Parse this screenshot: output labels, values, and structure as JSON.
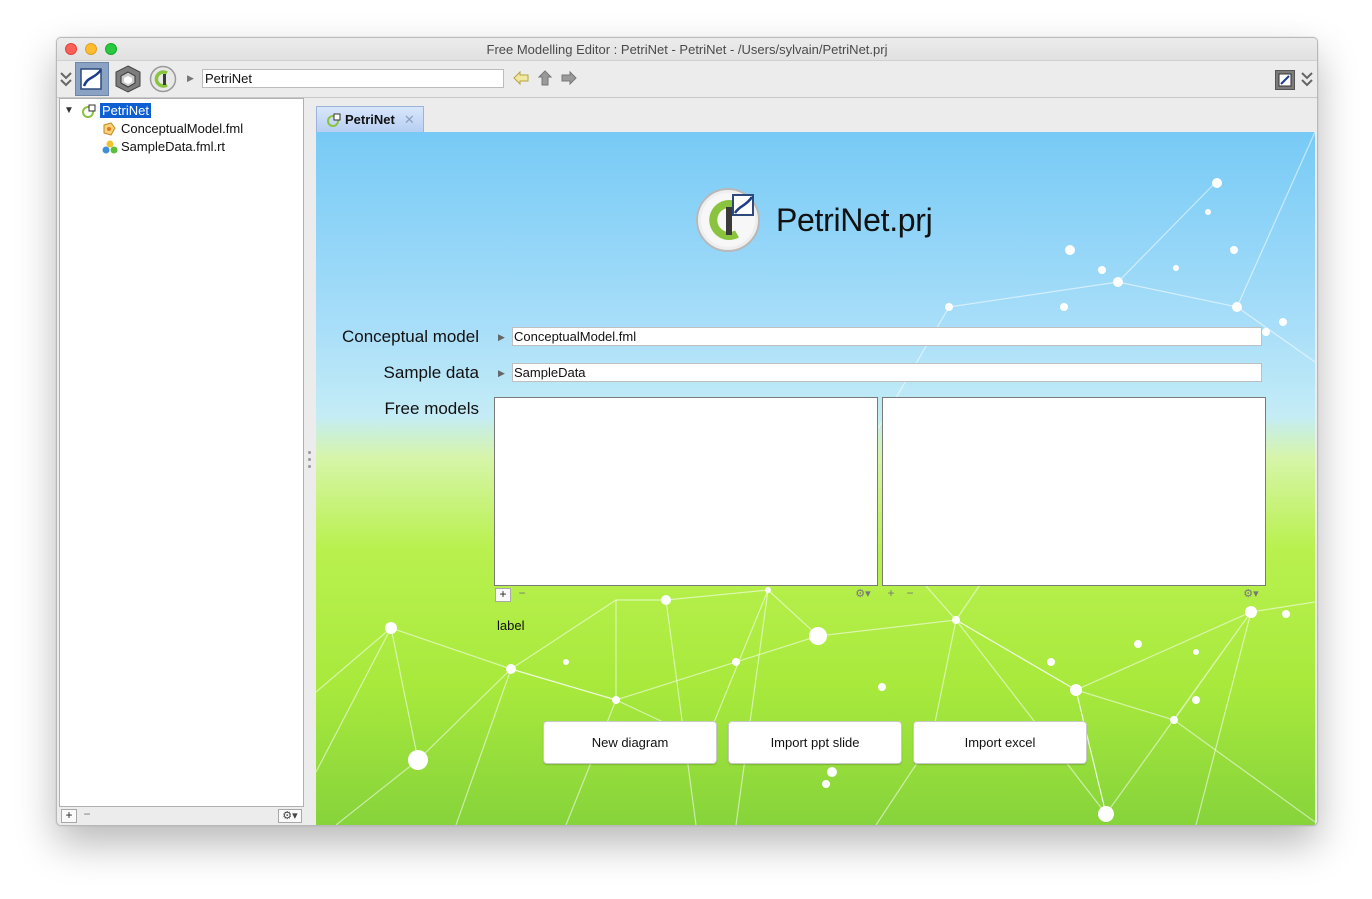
{
  "window": {
    "title": "Free Modelling Editor : PetriNet - PetriNet - /Users/sylvain/PetriNet.prj"
  },
  "toolbar": {
    "path_value": "PetriNet",
    "icons": [
      "collapse-chevrons-icon",
      "free-modelling-perspective-icon",
      "technology-cube-icon",
      "openflexo-logo-icon",
      "back-arrow-icon",
      "up-arrow-icon",
      "forward-arrow-icon",
      "toggle-inspector-icon",
      "expand-chevrons-icon"
    ]
  },
  "tree": {
    "root": "PetriNet",
    "children": [
      "ConceptualModel.fml",
      "SampleData.fml.rt"
    ]
  },
  "left_footer": {
    "add": "+",
    "remove": "−",
    "gear": "⚙▾"
  },
  "tab": {
    "label": "PetriNet",
    "close": "✕"
  },
  "main": {
    "project_title": "PetriNet.prj",
    "conceptual_model_label": "Conceptual model",
    "conceptual_model_value": "ConceptualModel.fml",
    "sample_data_label": "Sample data",
    "sample_data_value": "SampleData",
    "free_models_label": "Free models",
    "list_add": "+",
    "list_remove": "−",
    "list_gear": "⚙▾",
    "label_text": "label",
    "buttons": {
      "new_diagram": "New diagram",
      "import_ppt": "Import ppt slide",
      "import_excel": "Import excel"
    }
  },
  "colors": {
    "selection": "#0d5fd2",
    "tab_bg": "#c7daf6",
    "sky": "#77caf6",
    "lime": "#b9f14f"
  }
}
